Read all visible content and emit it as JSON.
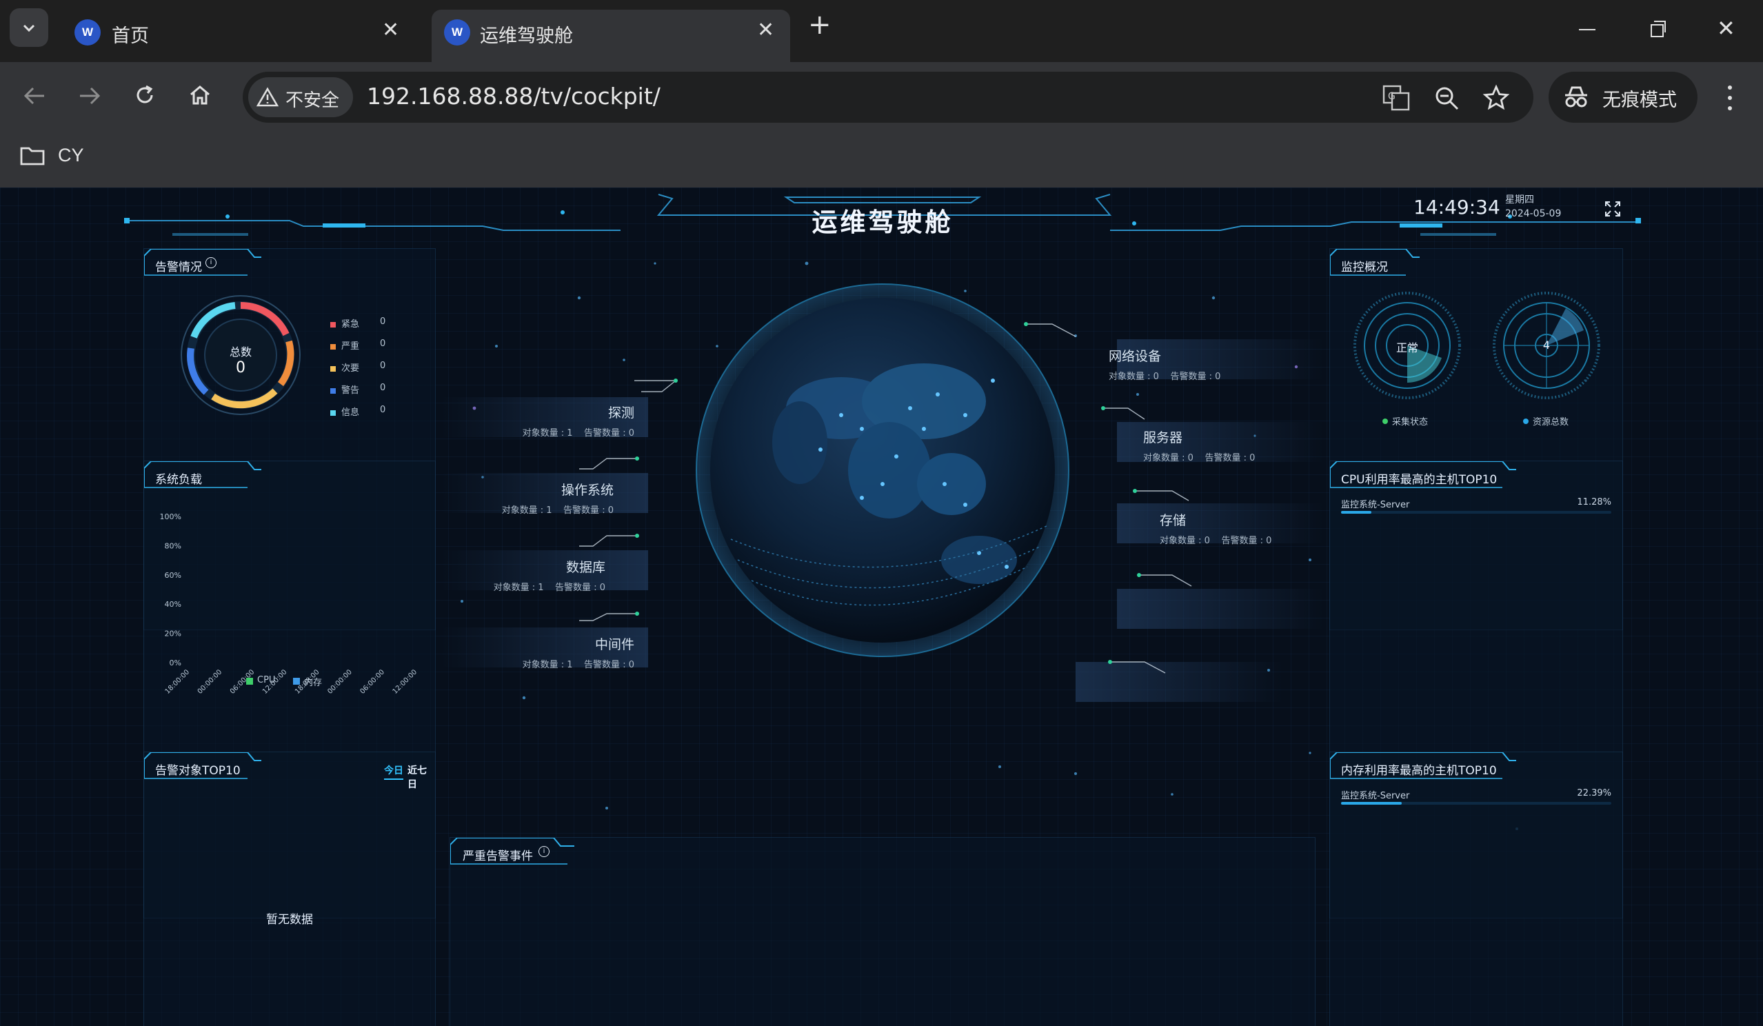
{
  "browser": {
    "tabs": [
      {
        "title": "首页",
        "active": false
      },
      {
        "title": "运维驾驶舱",
        "active": true
      }
    ],
    "security_label": "不安全",
    "url": "192.168.88.88/tv/cockpit/",
    "incognito_label": "无痕模式",
    "bookmarks": [
      {
        "label": "CY",
        "icon": "folder-icon"
      }
    ]
  },
  "page": {
    "title": "运维驾驶舱",
    "time": "14:49:34",
    "weekday": "星期四",
    "date": "2024-05-09"
  },
  "alarm_panel": {
    "title": "告警情况",
    "total_label": "总数",
    "total_value": "0",
    "legend": [
      {
        "label": "紧急",
        "value": "0",
        "color": "#f0575f"
      },
      {
        "label": "严重",
        "value": "0",
        "color": "#f08d3c"
      },
      {
        "label": "次要",
        "value": "0",
        "color": "#f5c25a"
      },
      {
        "label": "警告",
        "value": "0",
        "color": "#3f7de8"
      },
      {
        "label": "信息",
        "value": "0",
        "color": "#5ad7f0"
      }
    ]
  },
  "load_panel": {
    "title": "系统负载",
    "legend": [
      {
        "label": "CPU",
        "color": "#3fcf6a"
      },
      {
        "label": "内存",
        "color": "#3f9be8"
      }
    ]
  },
  "chart_data": {
    "type": "line",
    "title": "系统负载",
    "categories": [
      "18:00:00",
      "00:00:00",
      "06:00:00",
      "12:00:00",
      "18:00:00",
      "00:00:00",
      "06:00:00",
      "12:00:00"
    ],
    "y_ticks": [
      "100%",
      "80%",
      "60%",
      "40%",
      "20%",
      "0%"
    ],
    "ylim": [
      0,
      100
    ],
    "series": [
      {
        "name": "CPU",
        "values": []
      },
      {
        "name": "内存",
        "values": []
      }
    ],
    "legend": "bottom"
  },
  "alarm_top10": {
    "title": "告警对象TOP10",
    "tabs": [
      "今日",
      "近七日"
    ],
    "empty_text": "暂无数据"
  },
  "severe_events": {
    "title": "严重告警事件"
  },
  "categories": [
    {
      "name": "探测",
      "obj_label": "对象数量",
      "obj_value": "1",
      "alarm_label": "告警数量",
      "alarm_value": "0"
    },
    {
      "name": "操作系统",
      "obj_label": "对象数量",
      "obj_value": "1",
      "alarm_label": "告警数量",
      "alarm_value": "0"
    },
    {
      "name": "数据库",
      "obj_label": "对象数量",
      "obj_value": "1",
      "alarm_label": "告警数量",
      "alarm_value": "0"
    },
    {
      "name": "中间件",
      "obj_label": "对象数量",
      "obj_value": "1",
      "alarm_label": "告警数量",
      "alarm_value": "0"
    },
    {
      "name": "网络设备",
      "obj_label": "对象数量",
      "obj_value": "0",
      "alarm_label": "告警数量",
      "alarm_value": "0"
    },
    {
      "name": "服务器",
      "obj_label": "对象数量",
      "obj_value": "0",
      "alarm_label": "告警数量",
      "alarm_value": "0"
    },
    {
      "name": "存储",
      "obj_label": "对象数量",
      "obj_value": "0",
      "alarm_label": "告警数量",
      "alarm_value": "0"
    }
  ],
  "monitor_overview": {
    "title": "监控概况",
    "status_value": "正常",
    "status_label": "采集状态",
    "resource_value": "4",
    "resource_label": "资源总数"
  },
  "cpu_top10": {
    "title": "CPU利用率最高的主机TOP10",
    "rows": [
      {
        "name": "监控系统-Server",
        "percent": "11.28%",
        "fraction": 0.1128
      }
    ]
  },
  "mem_top10": {
    "title": "内存利用率最高的主机TOP10",
    "rows": [
      {
        "name": "监控系统-Server",
        "percent": "22.39%",
        "fraction": 0.2239
      }
    ]
  }
}
